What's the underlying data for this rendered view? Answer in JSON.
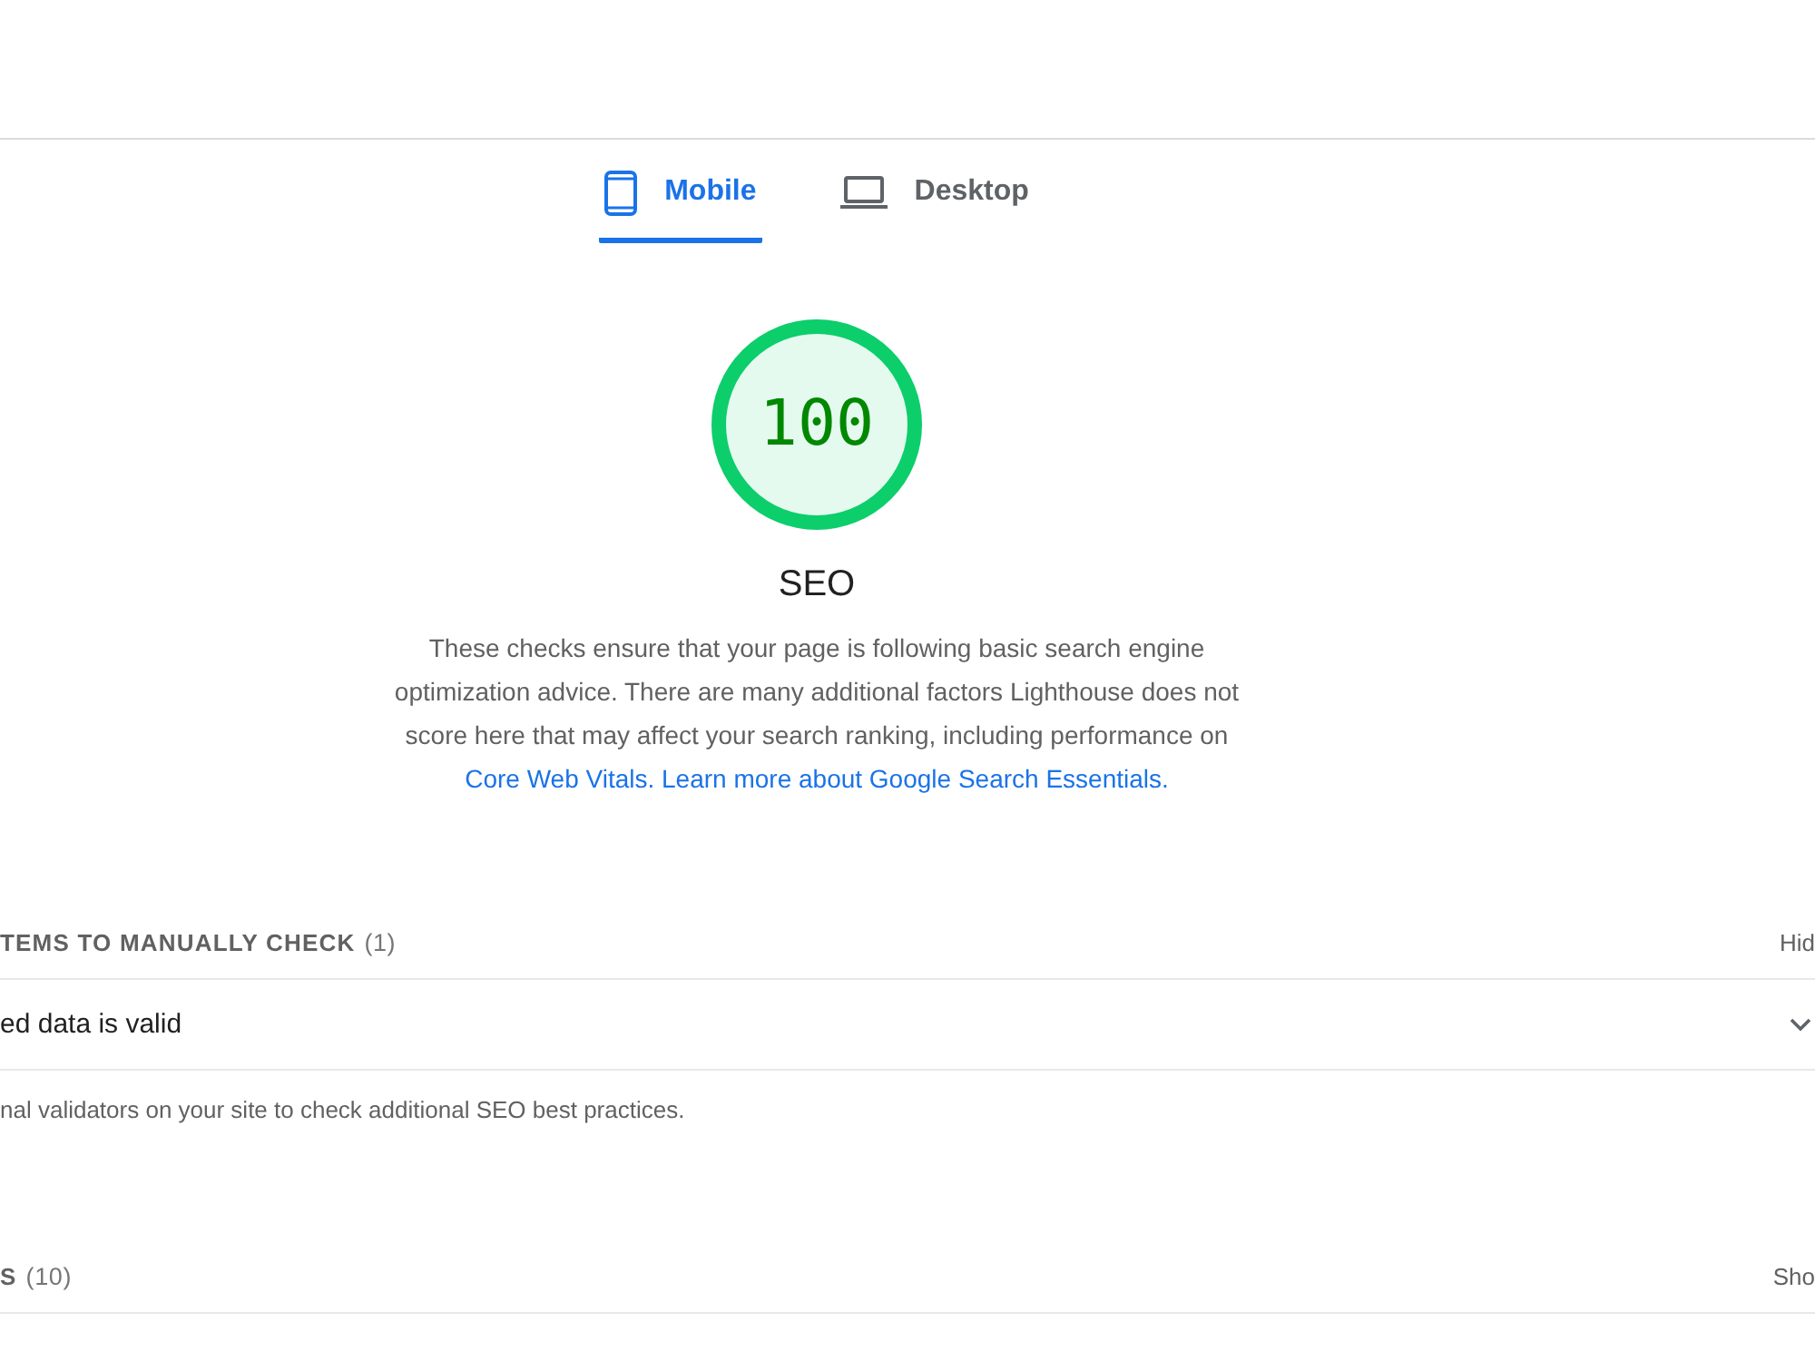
{
  "tabs": [
    {
      "label": "Mobile",
      "selected": true
    },
    {
      "label": "Desktop",
      "selected": false
    }
  ],
  "gauge": {
    "score": "100",
    "title": "SEO",
    "description": "These checks ensure that your page is following basic search engine optimization advice. There are many additional factors Lighthouse does not score here that may affect your search ranking, including performance on",
    "links": [
      "Core Web Vitals.",
      "Learn more about Google Search Essentials."
    ]
  },
  "groups": [
    {
      "title": "TEMS TO MANUALLY CHECK",
      "count": "(1)",
      "toggle": "Hid",
      "audits": [
        {
          "title": "ed data is valid",
          "expanded": false
        }
      ],
      "description": "nal validators on your site to check additional SEO best practices."
    },
    {
      "title": "S",
      "count": "(10)",
      "toggle": "Sho"
    }
  ]
}
